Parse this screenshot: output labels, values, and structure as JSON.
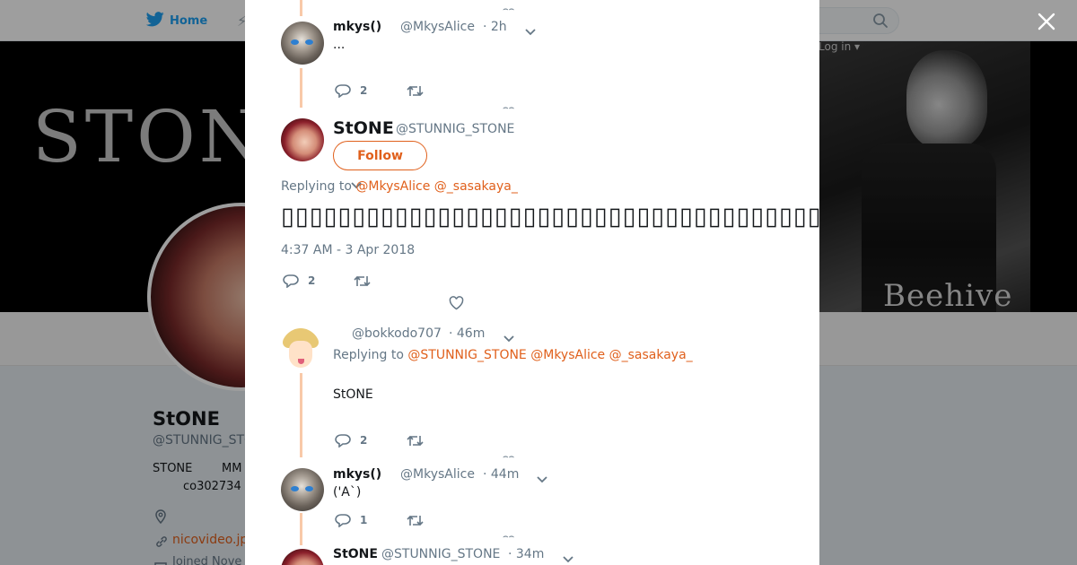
{
  "topnav": {
    "home_label": "Home",
    "login_label": "Log in ▾"
  },
  "banner": {
    "title_text": "STONE",
    "art_label": "Beehive"
  },
  "profile": {
    "name": "StONE",
    "handle": "@STUNNIG_STONE",
    "bio_line1a": "STONE",
    "bio_line1b": "MM",
    "bio_line2": "co302734",
    "link": "nicovideo.jp",
    "joined": "Joined Nove"
  },
  "colors": {
    "accent": "#e0601c",
    "thread_line": "#f8c9a9",
    "muted": "#657786"
  },
  "thread": {
    "tweet1": {
      "name": "mkys()",
      "handle": "@MkysAlice",
      "time": "· 2h",
      "text": "...",
      "reply_count": "2"
    },
    "main": {
      "name": "StONE",
      "handle": "@STUNNIG_STONE",
      "follow_label": "Follow",
      "replying_prefix": "Replying to",
      "mention1": "@MkysAlice",
      "mention2": "@_sasakaya_",
      "text": "▯▯▯▯▯▯▯▯▯▯▯▯▯▯▯▯▯▯▯▯▯▯▯▯▯▯▯▯▯▯▯▯▯▯▯▯▯▯▯▯▯",
      "date": "4:37 AM - 3 Apr 2018",
      "reply_count": "2"
    },
    "tweet3": {
      "handle": "@bokkodo707",
      "time": "· 46m",
      "replying_prefix": "Replying to",
      "mention1": "@STUNNIG_STONE",
      "mention2": "@MkysAlice",
      "mention3": "@_sasakaya_",
      "text": "StONE",
      "reply_count": "2"
    },
    "tweet4": {
      "name": "mkys()",
      "handle": "@MkysAlice",
      "time": "· 44m",
      "text": "('A`)",
      "reply_count": "1"
    },
    "tweet5": {
      "name": "StONE",
      "handle": "@STUNNIG_STONE",
      "time": "· 34m"
    }
  },
  "icons": [
    "bird-icon",
    "lightning-icon",
    "search-icon",
    "close-icon",
    "reply-icon",
    "retweet-icon",
    "like-icon",
    "chevron-down-icon",
    "location-icon",
    "link-icon",
    "calendar-icon"
  ]
}
